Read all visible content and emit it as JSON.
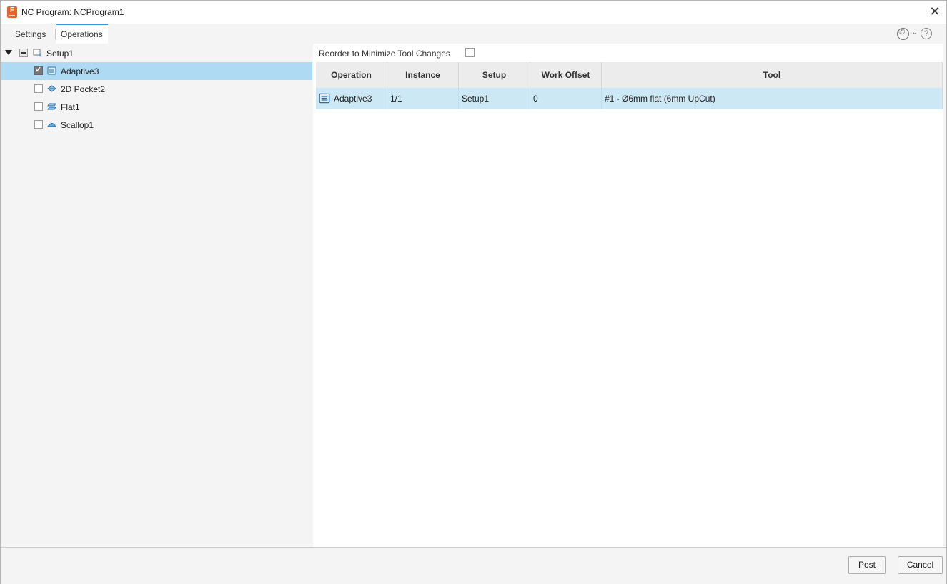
{
  "window": {
    "title": "NC Program: NCProgram1",
    "app_icon_letter": "F"
  },
  "tabs": [
    {
      "label": "Settings",
      "active": false
    },
    {
      "label": "Operations",
      "active": true
    }
  ],
  "toolbar": {
    "icons": [
      "phone-icon",
      "chevron-down-icon",
      "help-icon"
    ],
    "help_glyph": "?"
  },
  "tree": {
    "root": {
      "label": "Setup1",
      "state": "partial",
      "icon": "setup-icon"
    },
    "items": [
      {
        "label": "Adaptive3",
        "checked": true,
        "selected": true,
        "icon": "adaptive-icon"
      },
      {
        "label": "2D Pocket2",
        "checked": false,
        "selected": false,
        "icon": "pocket-icon"
      },
      {
        "label": "Flat1",
        "checked": false,
        "selected": false,
        "icon": "flat-icon"
      },
      {
        "label": "Scallop1",
        "checked": false,
        "selected": false,
        "icon": "scallop-icon"
      }
    ]
  },
  "reorder": {
    "label": "Reorder to Minimize Tool Changes",
    "checked": false
  },
  "grid": {
    "columns": [
      "Operation",
      "Instance",
      "Setup",
      "Work Offset",
      "Tool"
    ],
    "rows": [
      {
        "operation": "Adaptive3",
        "instance": "1/1",
        "setup": "Setup1",
        "work_offset": "0",
        "tool": "#1 - Ø6mm flat (6mm UpCut)"
      }
    ]
  },
  "buttons": {
    "post": "Post",
    "cancel": "Cancel"
  },
  "colors": {
    "selection": "#aedbf3",
    "row_highlight": "#cce8f5",
    "tab_accent": "#3d99d8",
    "app_icon": "#e8622a"
  }
}
